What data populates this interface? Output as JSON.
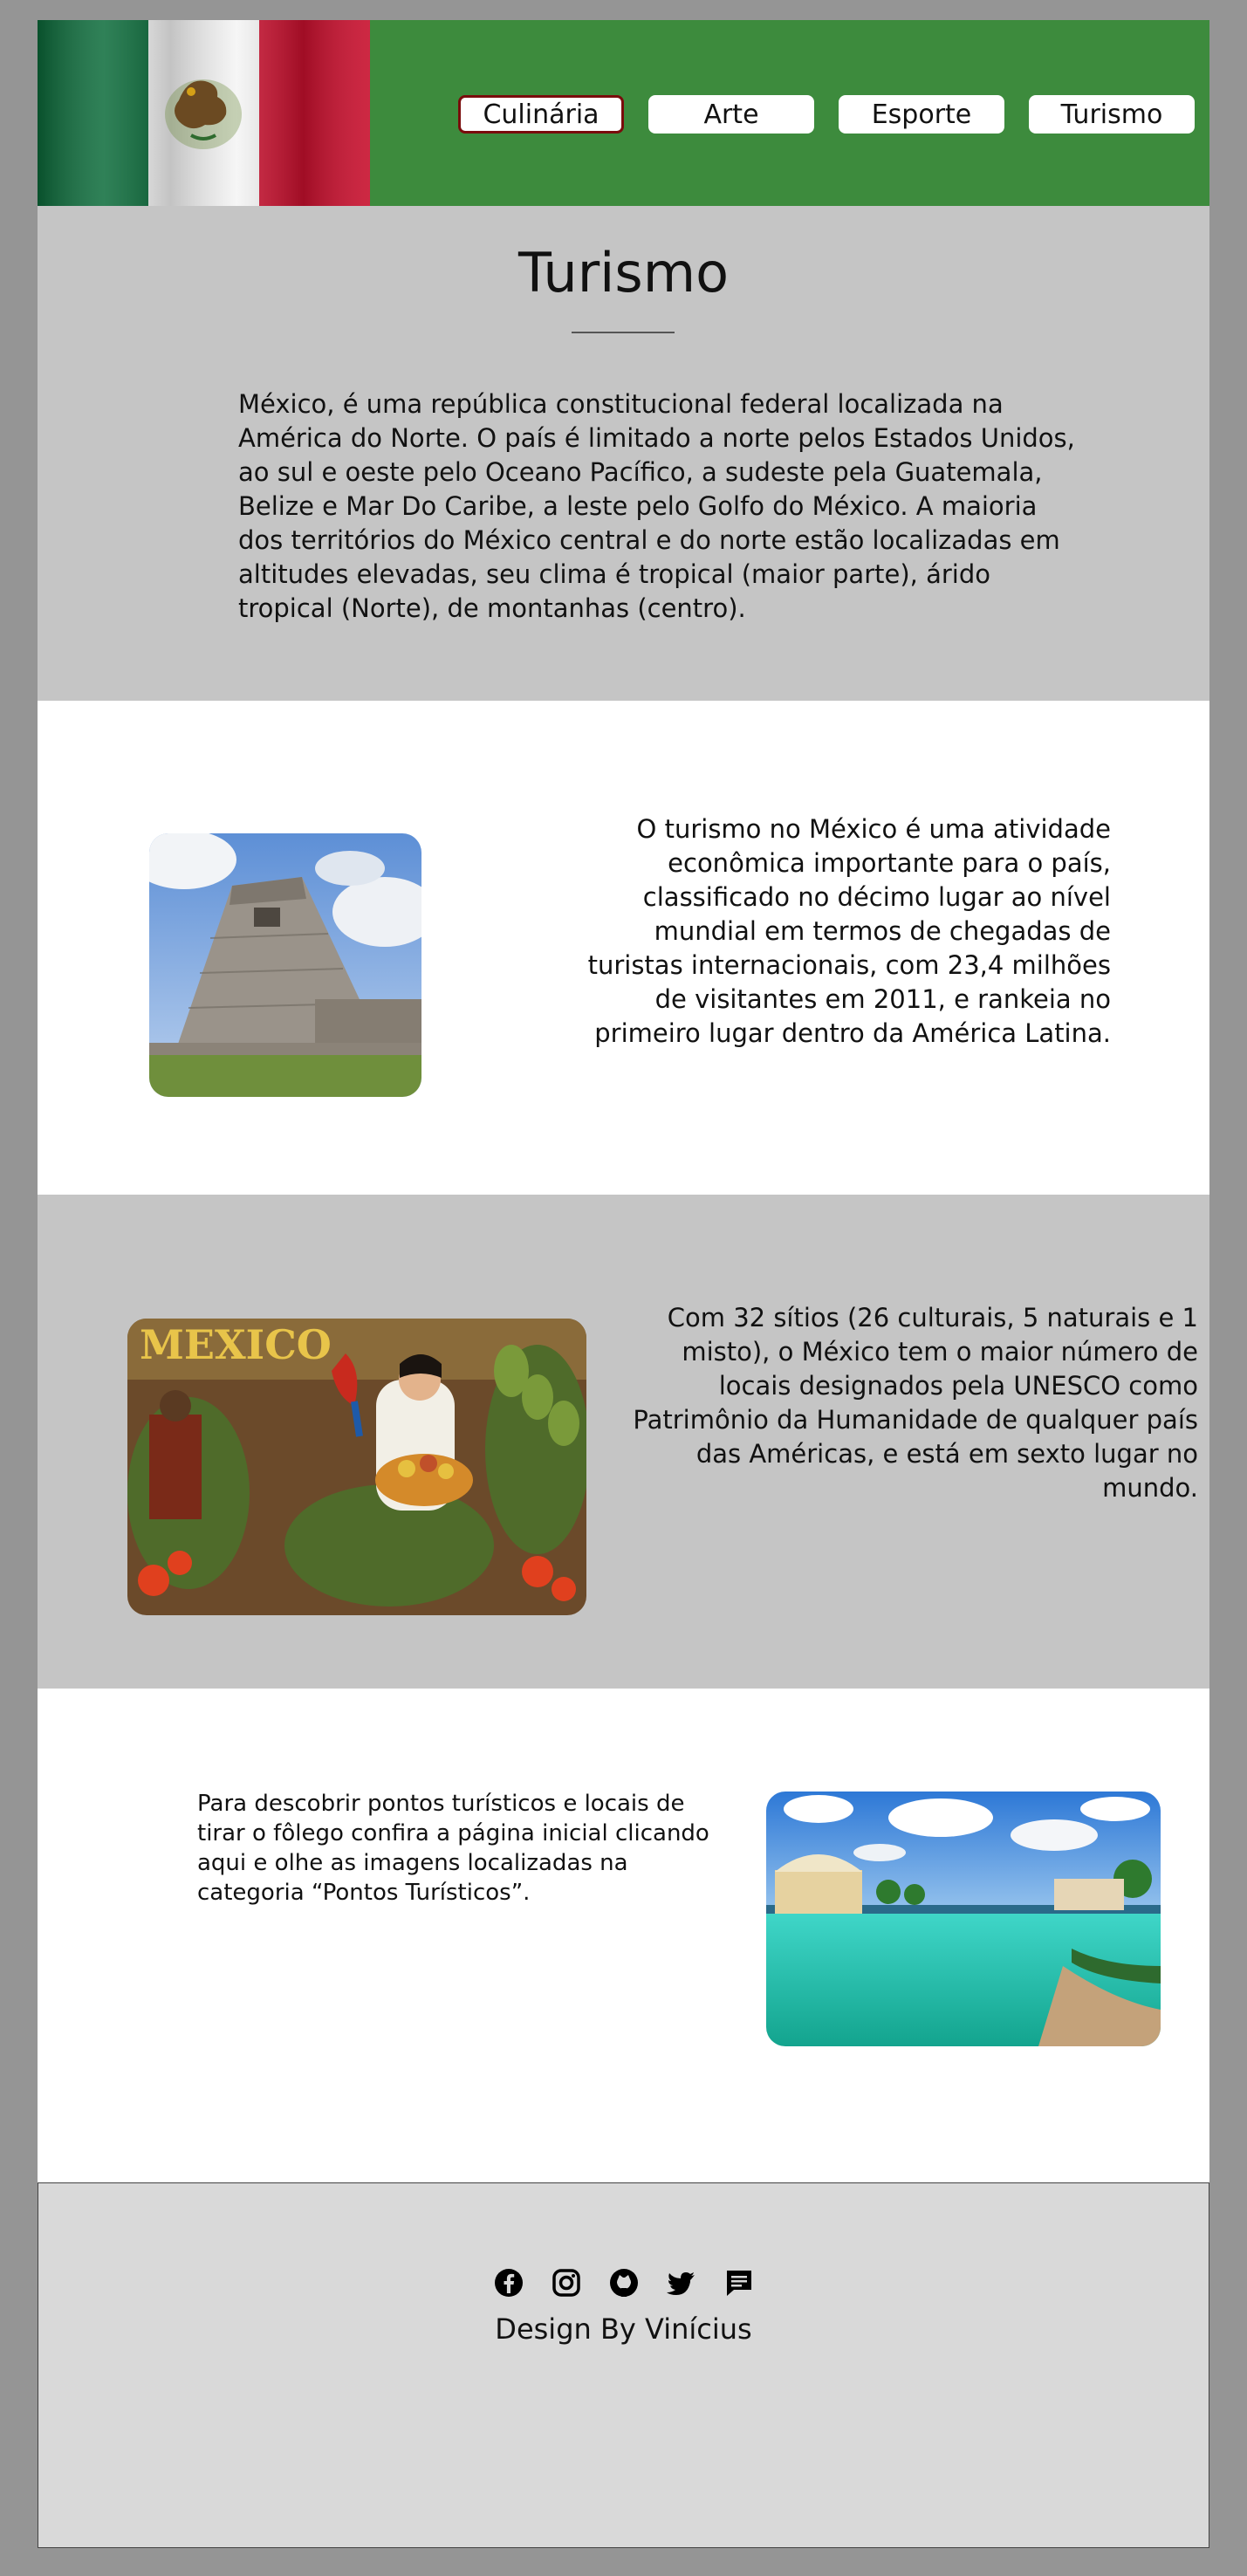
{
  "nav": {
    "items": [
      {
        "label": "Culinária",
        "active": true
      },
      {
        "label": "Arte",
        "active": false
      },
      {
        "label": "Esporte",
        "active": false
      },
      {
        "label": "Turismo",
        "active": false
      }
    ]
  },
  "intro": {
    "title": "Turismo",
    "text": "México, é uma república constitucional federal localizada na América do Norte. O país é limitado a norte pelos Estados Unidos, ao sul e oeste pelo Oceano Pacífico, a sudeste pela Guatemala, Belize e Mar Do Caribe, a leste pelo Golfo do México. A maioria dos territórios do México central e do norte estão localizadas em altitudes elevadas, seu clima é tropical (maior parte), árido tropical (Norte), de montanhas (centro)."
  },
  "section1": {
    "text": "O turismo no México é uma atividade econômica importante para o país, classificado no décimo lugar ao nível mundial em termos de chegadas de turistas internacionais, com 23,4 milhões de visitantes em 2011, e rankeia no primeiro lugar dentro da América Latina."
  },
  "section2": {
    "poster_title": "MEXICO",
    "text": "Com 32 sítios (26 culturais, 5 naturais e 1 misto), o México tem o maior número de locais designados pela UNESCO como Patrimônio da Humanidade de qualquer país das Américas, e está em sexto lugar no mundo."
  },
  "section3": {
    "text": "Para descobrir pontos turísticos e locais de tirar o fôlego confira a página inicial clicando aqui e olhe as imagens localizadas na categoria “Pontos Turísticos”."
  },
  "footer": {
    "icons": [
      "facebook-icon",
      "instagram-icon",
      "github-icon",
      "twitter-icon",
      "chat-icon"
    ],
    "credit": "Design By Vinícius"
  },
  "colors": {
    "header_green": "#3d8b3d",
    "band_gray": "#c5c5c5",
    "footer_gray": "#d9d9d9",
    "active_border": "#7a0c0c",
    "page_background": "#959595"
  }
}
